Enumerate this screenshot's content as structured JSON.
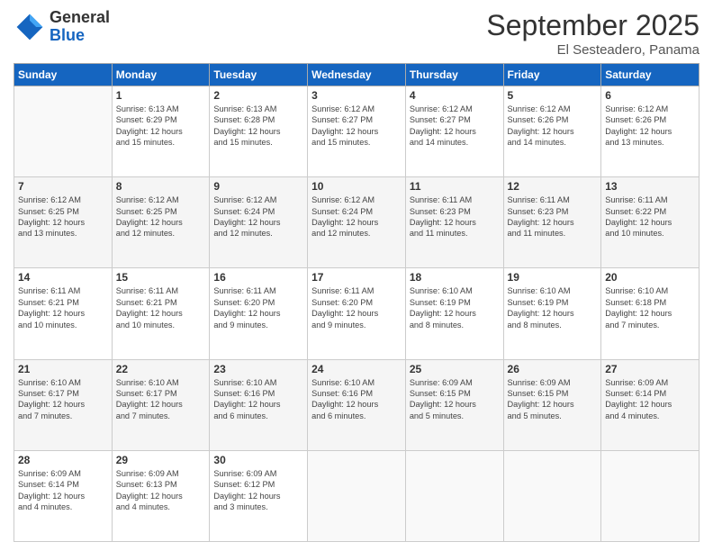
{
  "logo": {
    "line1": "General",
    "line2": "Blue"
  },
  "title": "September 2025",
  "location": "El Sesteadero, Panama",
  "days_of_week": [
    "Sunday",
    "Monday",
    "Tuesday",
    "Wednesday",
    "Thursday",
    "Friday",
    "Saturday"
  ],
  "weeks": [
    [
      {
        "day": "",
        "info": ""
      },
      {
        "day": "1",
        "info": "Sunrise: 6:13 AM\nSunset: 6:29 PM\nDaylight: 12 hours\nand 15 minutes."
      },
      {
        "day": "2",
        "info": "Sunrise: 6:13 AM\nSunset: 6:28 PM\nDaylight: 12 hours\nand 15 minutes."
      },
      {
        "day": "3",
        "info": "Sunrise: 6:12 AM\nSunset: 6:27 PM\nDaylight: 12 hours\nand 15 minutes."
      },
      {
        "day": "4",
        "info": "Sunrise: 6:12 AM\nSunset: 6:27 PM\nDaylight: 12 hours\nand 14 minutes."
      },
      {
        "day": "5",
        "info": "Sunrise: 6:12 AM\nSunset: 6:26 PM\nDaylight: 12 hours\nand 14 minutes."
      },
      {
        "day": "6",
        "info": "Sunrise: 6:12 AM\nSunset: 6:26 PM\nDaylight: 12 hours\nand 13 minutes."
      }
    ],
    [
      {
        "day": "7",
        "info": "Sunrise: 6:12 AM\nSunset: 6:25 PM\nDaylight: 12 hours\nand 13 minutes."
      },
      {
        "day": "8",
        "info": "Sunrise: 6:12 AM\nSunset: 6:25 PM\nDaylight: 12 hours\nand 12 minutes."
      },
      {
        "day": "9",
        "info": "Sunrise: 6:12 AM\nSunset: 6:24 PM\nDaylight: 12 hours\nand 12 minutes."
      },
      {
        "day": "10",
        "info": "Sunrise: 6:12 AM\nSunset: 6:24 PM\nDaylight: 12 hours\nand 12 minutes."
      },
      {
        "day": "11",
        "info": "Sunrise: 6:11 AM\nSunset: 6:23 PM\nDaylight: 12 hours\nand 11 minutes."
      },
      {
        "day": "12",
        "info": "Sunrise: 6:11 AM\nSunset: 6:23 PM\nDaylight: 12 hours\nand 11 minutes."
      },
      {
        "day": "13",
        "info": "Sunrise: 6:11 AM\nSunset: 6:22 PM\nDaylight: 12 hours\nand 10 minutes."
      }
    ],
    [
      {
        "day": "14",
        "info": "Sunrise: 6:11 AM\nSunset: 6:21 PM\nDaylight: 12 hours\nand 10 minutes."
      },
      {
        "day": "15",
        "info": "Sunrise: 6:11 AM\nSunset: 6:21 PM\nDaylight: 12 hours\nand 10 minutes."
      },
      {
        "day": "16",
        "info": "Sunrise: 6:11 AM\nSunset: 6:20 PM\nDaylight: 12 hours\nand 9 minutes."
      },
      {
        "day": "17",
        "info": "Sunrise: 6:11 AM\nSunset: 6:20 PM\nDaylight: 12 hours\nand 9 minutes."
      },
      {
        "day": "18",
        "info": "Sunrise: 6:10 AM\nSunset: 6:19 PM\nDaylight: 12 hours\nand 8 minutes."
      },
      {
        "day": "19",
        "info": "Sunrise: 6:10 AM\nSunset: 6:19 PM\nDaylight: 12 hours\nand 8 minutes."
      },
      {
        "day": "20",
        "info": "Sunrise: 6:10 AM\nSunset: 6:18 PM\nDaylight: 12 hours\nand 7 minutes."
      }
    ],
    [
      {
        "day": "21",
        "info": "Sunrise: 6:10 AM\nSunset: 6:17 PM\nDaylight: 12 hours\nand 7 minutes."
      },
      {
        "day": "22",
        "info": "Sunrise: 6:10 AM\nSunset: 6:17 PM\nDaylight: 12 hours\nand 7 minutes."
      },
      {
        "day": "23",
        "info": "Sunrise: 6:10 AM\nSunset: 6:16 PM\nDaylight: 12 hours\nand 6 minutes."
      },
      {
        "day": "24",
        "info": "Sunrise: 6:10 AM\nSunset: 6:16 PM\nDaylight: 12 hours\nand 6 minutes."
      },
      {
        "day": "25",
        "info": "Sunrise: 6:09 AM\nSunset: 6:15 PM\nDaylight: 12 hours\nand 5 minutes."
      },
      {
        "day": "26",
        "info": "Sunrise: 6:09 AM\nSunset: 6:15 PM\nDaylight: 12 hours\nand 5 minutes."
      },
      {
        "day": "27",
        "info": "Sunrise: 6:09 AM\nSunset: 6:14 PM\nDaylight: 12 hours\nand 4 minutes."
      }
    ],
    [
      {
        "day": "28",
        "info": "Sunrise: 6:09 AM\nSunset: 6:14 PM\nDaylight: 12 hours\nand 4 minutes."
      },
      {
        "day": "29",
        "info": "Sunrise: 6:09 AM\nSunset: 6:13 PM\nDaylight: 12 hours\nand 4 minutes."
      },
      {
        "day": "30",
        "info": "Sunrise: 6:09 AM\nSunset: 6:12 PM\nDaylight: 12 hours\nand 3 minutes."
      },
      {
        "day": "",
        "info": ""
      },
      {
        "day": "",
        "info": ""
      },
      {
        "day": "",
        "info": ""
      },
      {
        "day": "",
        "info": ""
      }
    ]
  ]
}
